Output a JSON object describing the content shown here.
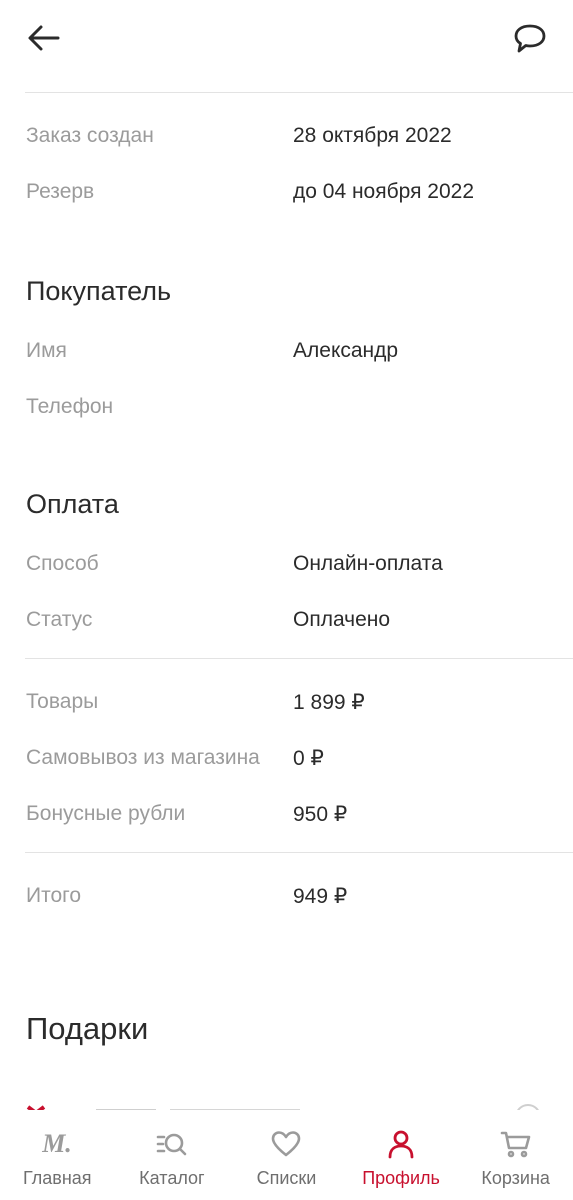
{
  "header": {
    "back_icon": "arrow-left-icon",
    "chat_icon": "chat-bubble-icon"
  },
  "order": {
    "created_label": "Заказ создан",
    "created_value": "28 октября 2022",
    "reserve_label": "Резерв",
    "reserve_value": "до 04 ноября 2022"
  },
  "buyer": {
    "title": "Покупатель",
    "name_label": "Имя",
    "name_value": "Александр",
    "phone_label": "Телефон"
  },
  "payment": {
    "title": "Оплата",
    "method_label": "Способ",
    "method_value": "Онлайн-оплата",
    "status_label": "Статус",
    "status_value": "Оплачено"
  },
  "summary": {
    "goods_label": "Товары",
    "goods_value": "1 899 ₽",
    "pickup_label": "Самовывоз из магазина",
    "pickup_value": "0 ₽",
    "bonus_label": "Бонусные рубли",
    "bonus_value": "950 ₽",
    "total_label": "Итого",
    "total_value": "949 ₽"
  },
  "gifts": {
    "title": "Подарки"
  },
  "nav": {
    "active_color": "#c8102e",
    "items": [
      {
        "label": "Главная",
        "icon": "m-logo-icon"
      },
      {
        "label": "Каталог",
        "icon": "catalog-search-icon"
      },
      {
        "label": "Списки",
        "icon": "heart-icon"
      },
      {
        "label": "Профиль",
        "icon": "profile-icon"
      },
      {
        "label": "Корзина",
        "icon": "cart-icon"
      }
    ]
  }
}
